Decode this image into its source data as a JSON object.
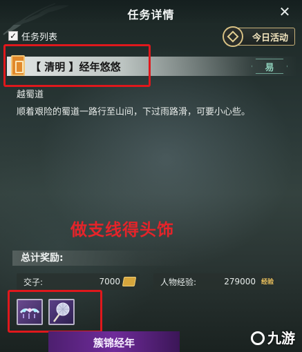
{
  "header": {
    "title": "任务详情",
    "close_icon": "close-icon"
  },
  "task_list": {
    "label": "任务列表",
    "checked": true
  },
  "today_activity": {
    "label": "今日活动",
    "icon": "diamond-emblem-icon"
  },
  "quest": {
    "name": "【 清明 】经年悠悠",
    "difficulty": "易",
    "location": "越蜀道",
    "description": "顺着艰险的蜀道一路行至山间，下过雨路滑，可要小心些。"
  },
  "overlay_note": "做支线得头饰",
  "rewards": {
    "title": "总计奖励:",
    "currency": {
      "label": "交子:",
      "value": "7000",
      "icon": "coin-icon"
    },
    "exp": {
      "label": "人物经验:",
      "value": "279000",
      "icon_text": "经验"
    }
  },
  "items": [
    {
      "icon": "headdress-icon"
    },
    {
      "icon": "fan-icon"
    }
  ],
  "bottom_tab": {
    "label": "簇锦经年"
  },
  "watermark": {
    "text": "九游"
  },
  "colors": {
    "highlight_box": "#e0181c",
    "accent_gold": "#c9b27a"
  }
}
